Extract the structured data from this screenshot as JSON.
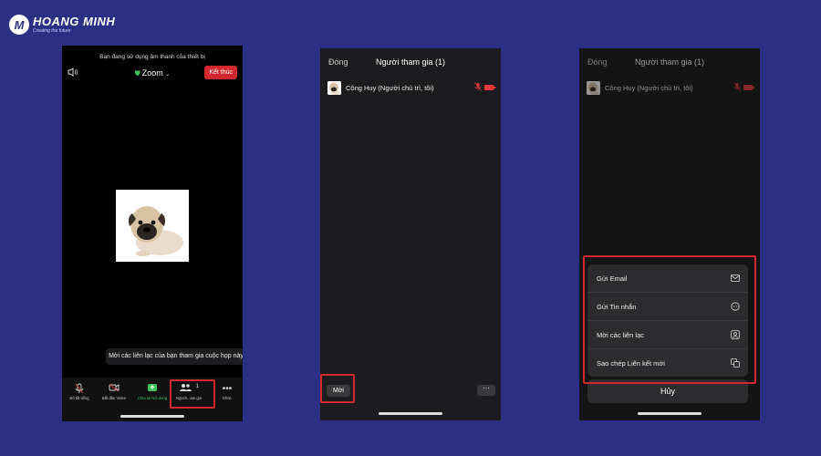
{
  "brand": {
    "name": "HOANG MINH",
    "tagline": "Creating the future",
    "mark": "M"
  },
  "phone1": {
    "audio_note": "Bạn đang sử dụng âm thanh của thiết bị",
    "app_title": "Zoom",
    "end_label": "Kết thúc",
    "tooltip": "Mời các liên lạc của bạn tham gia cuộc họp này",
    "participants_count": "1",
    "toolbar": [
      {
        "label": "Bỏ tắt tiếng",
        "icon": "mic-muted-icon"
      },
      {
        "label": "Bắt đầu Video",
        "icon": "video-off-icon"
      },
      {
        "label": "Chia sẻ Nội dung",
        "icon": "share-screen-icon"
      },
      {
        "label": "Người...am gia",
        "icon": "participants-icon"
      },
      {
        "label": "Khác",
        "icon": "more-icon"
      }
    ]
  },
  "phone2": {
    "close_label": "Đóng",
    "title": "Người tham gia (1)",
    "participant_name": "Công Huy (Người chủ trì, tôi)",
    "invite_label": "Mời",
    "more_label": "···"
  },
  "phone3": {
    "close_label": "Đóng",
    "title": "Người tham gia (1)",
    "participant_name": "Công Huy (Người chủ trì, tôi)",
    "options": [
      {
        "label": "Gửi Email",
        "icon": "mail-icon"
      },
      {
        "label": "Gửi Tin nhắn",
        "icon": "message-icon"
      },
      {
        "label": "Mời các liên lạc",
        "icon": "contact-icon"
      },
      {
        "label": "Sao chép Liên kết mời",
        "icon": "copy-icon"
      }
    ],
    "cancel_label": "Hủy"
  },
  "colors": {
    "background": "#2b3085",
    "highlight": "#d3272f",
    "accent_green": "#3cc35a",
    "mute_red": "#e0383e"
  }
}
